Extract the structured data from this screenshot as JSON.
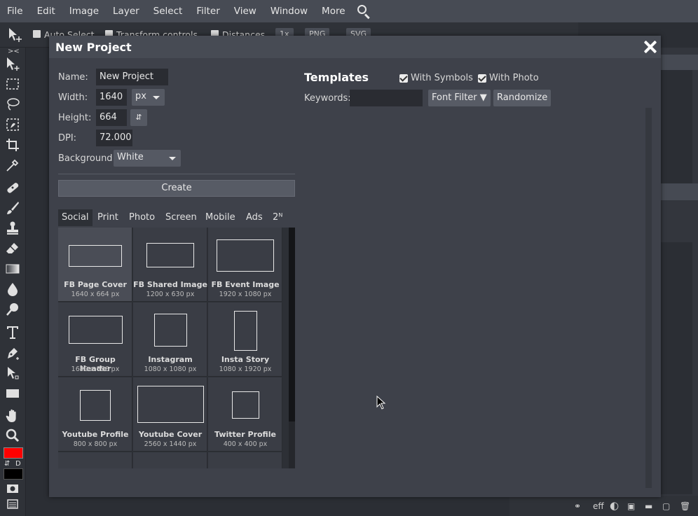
{
  "menubar": {
    "items": [
      "File",
      "Edit",
      "Image",
      "Layer",
      "Select",
      "Filter",
      "View",
      "Window",
      "More"
    ]
  },
  "options_bar": {
    "auto_select": "Auto Select",
    "transform_controls": "Transform controls",
    "distances": "Distances",
    "zoom": "1x",
    "png": "PNG",
    "svg": "SVG"
  },
  "colors": {
    "foreground": "#ff0000",
    "background": "#000000"
  },
  "swatch_labels": {
    "swap": "⇵",
    "default": "D"
  },
  "bottom_bar": {
    "eff": "eff"
  },
  "dialog": {
    "title": "New Project",
    "name_label": "Name:",
    "name_value": "New Project",
    "width_label": "Width:",
    "width_value": "1640",
    "unit": "px",
    "height_label": "Height:",
    "height_value": "664",
    "dpi_label": "DPI:",
    "dpi_value": "72.000",
    "background_label": "Background:",
    "background_value": "White",
    "create_label": "Create",
    "tabs": [
      "Social",
      "Print",
      "Photo",
      "Screen",
      "Mobile",
      "Ads",
      "2ᴺ"
    ],
    "presets": [
      {
        "name": "FB Page Cover",
        "size": "1640 x 664 px"
      },
      {
        "name": "FB Shared Image",
        "size": "1200 x 630 px"
      },
      {
        "name": "FB Event Image",
        "size": "1920 x 1080 px"
      },
      {
        "name": "FB Group Header",
        "size": "1640 x 856 px"
      },
      {
        "name": "Instagram",
        "size": "1080 x 1080 px"
      },
      {
        "name": "Insta Story",
        "size": "1080 x 1920 px"
      },
      {
        "name": "Youtube Profile",
        "size": "800 x 800 px"
      },
      {
        "name": "Youtube Cover",
        "size": "2560 x 1440 px"
      },
      {
        "name": "Twitter Profile",
        "size": "400 x 400 px"
      }
    ],
    "templates": {
      "title": "Templates",
      "with_symbols": "With Symbols",
      "with_photo": "With Photo",
      "keywords_label": "Keywords:",
      "keywords_value": "",
      "font_filter": "Font Filter ▼",
      "randomize": "Randomize"
    }
  }
}
